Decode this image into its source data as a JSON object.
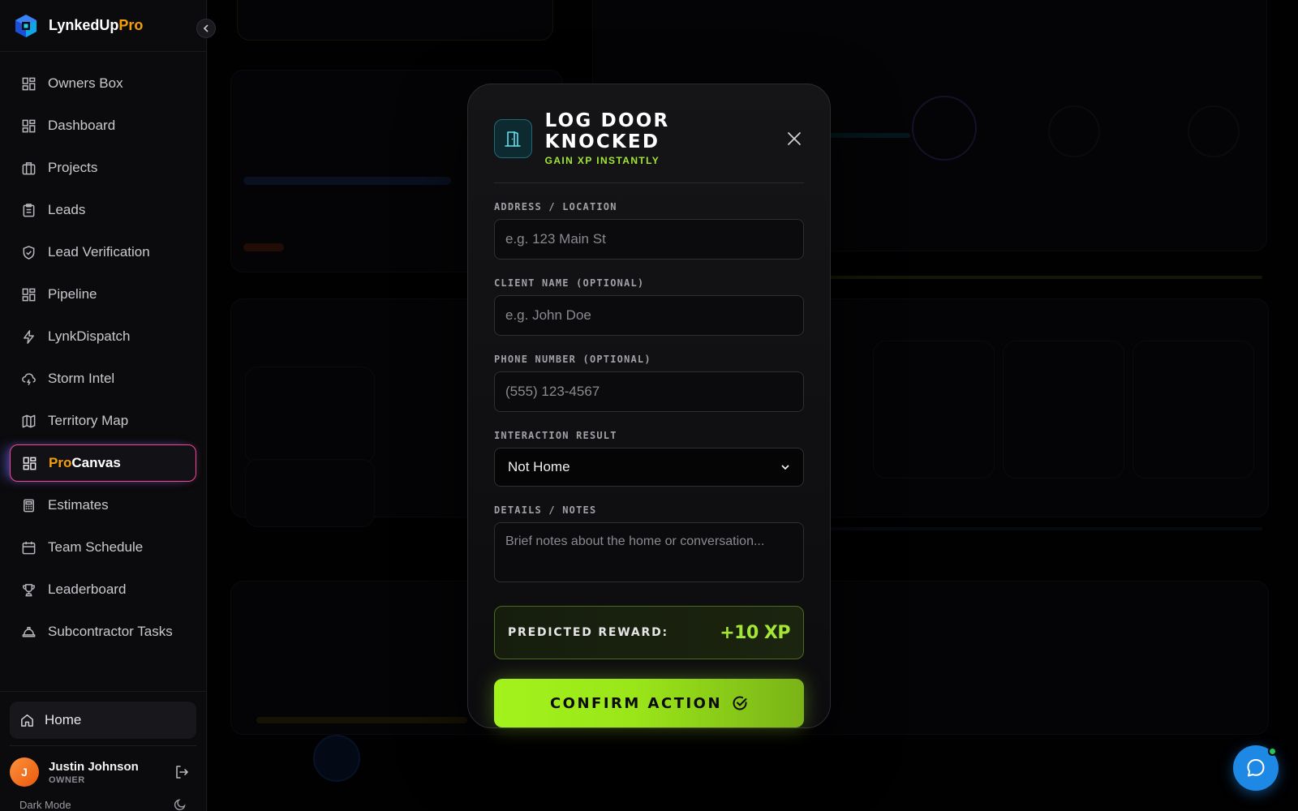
{
  "brand": {
    "name_main": "LynkedUp",
    "name_accent": "Pro"
  },
  "sidebar": {
    "items": [
      {
        "label": "Owners Box",
        "icon": "grid-icon"
      },
      {
        "label": "Dashboard",
        "icon": "grid-icon"
      },
      {
        "label": "Projects",
        "icon": "briefcase-icon"
      },
      {
        "label": "Leads",
        "icon": "clipboard-icon"
      },
      {
        "label": "Lead Verification",
        "icon": "shield-check-icon"
      },
      {
        "label": "Pipeline",
        "icon": "grid-icon"
      },
      {
        "label": "LynkDispatch",
        "icon": "zap-icon"
      },
      {
        "label": "Storm Intel",
        "icon": "cloud-lightning-icon"
      },
      {
        "label": "Territory Map",
        "icon": "map-icon"
      },
      {
        "label_accent": "Pro",
        "label_main": "Canvas",
        "icon": "grid-icon",
        "active": true
      },
      {
        "label": "Estimates",
        "icon": "calculator-icon"
      },
      {
        "label": "Team Schedule",
        "icon": "calendar-icon"
      },
      {
        "label": "Leaderboard",
        "icon": "trophy-icon"
      },
      {
        "label": "Subcontractor Tasks",
        "icon": "hard-hat-icon"
      }
    ],
    "home_label": "Home",
    "user": {
      "initial": "J",
      "name": "Justin Johnson",
      "role": "OWNER"
    },
    "dark_mode_label": "Dark Mode"
  },
  "modal": {
    "title": "LOG DOOR KNOCKED",
    "subtitle": "GAIN XP INSTANTLY",
    "address_label": "ADDRESS / LOCATION",
    "address_placeholder": "e.g. 123 Main St",
    "client_label": "CLIENT NAME (OPTIONAL)",
    "client_placeholder": "e.g. John Doe",
    "phone_label": "PHONE NUMBER (OPTIONAL)",
    "phone_placeholder": "(555) 123-4567",
    "result_label": "INTERACTION RESULT",
    "result_value": "Not Home",
    "notes_label": "DETAILS / NOTES",
    "notes_placeholder": "Brief notes about the home or conversation...",
    "reward_label": "PREDICTED REWARD:",
    "reward_value": "+10 XP",
    "confirm_label": "CONFIRM ACTION"
  },
  "colors": {
    "accent_green": "#a3e635",
    "accent_orange": "#f59e0b",
    "active_border": "#ec4899",
    "chat_blue": "#1e88e5"
  }
}
